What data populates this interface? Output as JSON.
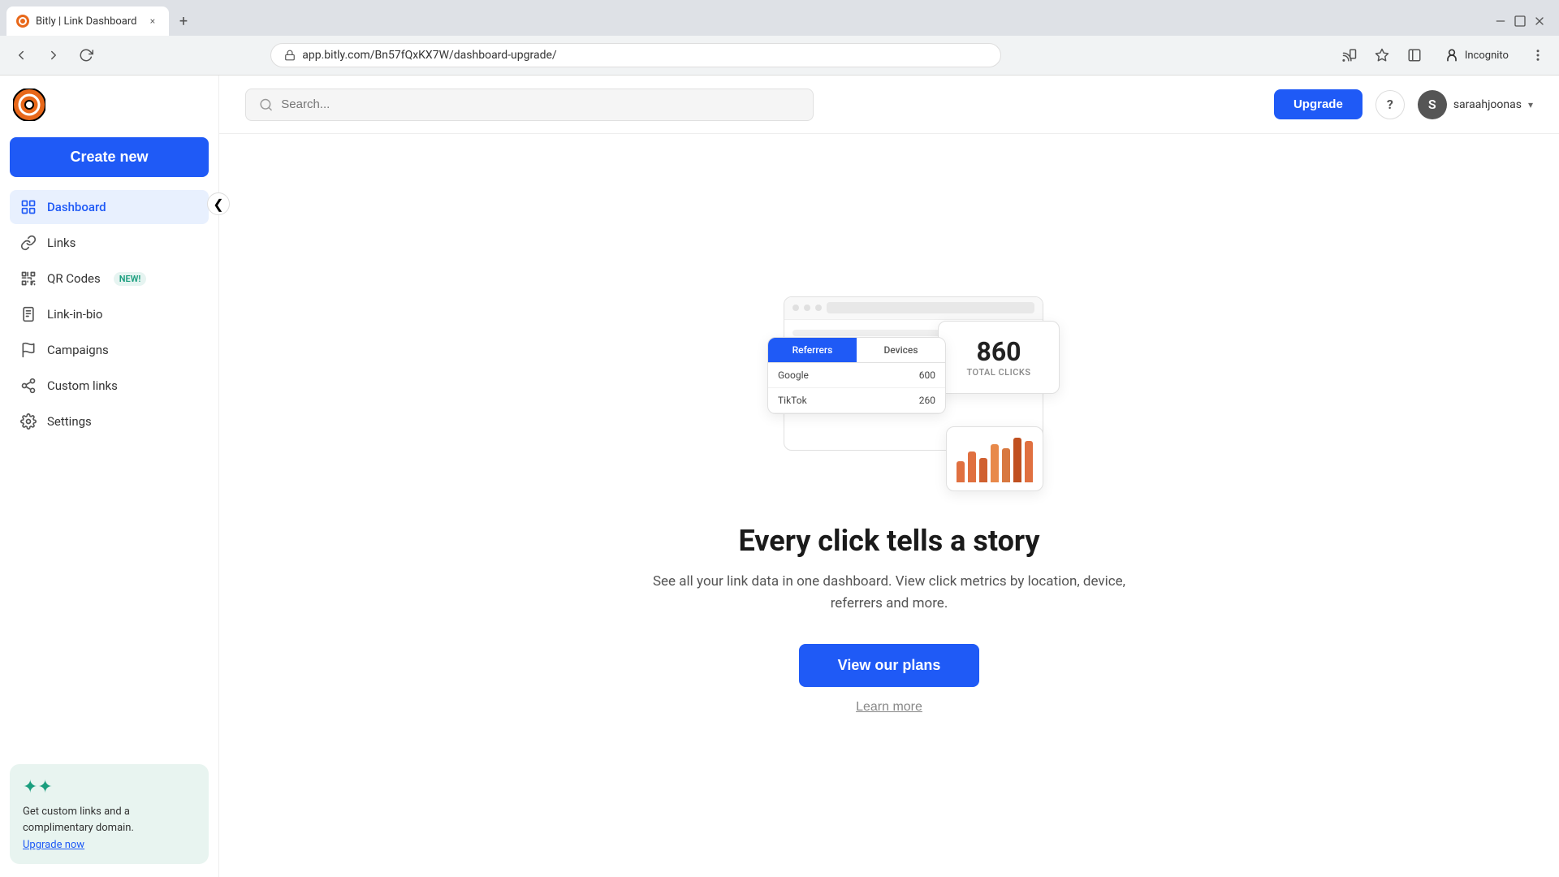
{
  "browser": {
    "tab_title": "Bitly | Link Dashboard",
    "tab_close_symbol": "×",
    "new_tab_symbol": "+",
    "url": "app.bitly.com/Bn57fQxKX7W/dashboard-upgrade/",
    "incognito_label": "Incognito"
  },
  "header": {
    "search_placeholder": "Search...",
    "upgrade_label": "Upgrade",
    "help_symbol": "?",
    "user_initial": "S",
    "user_name": "saraahjoonas",
    "chevron": "▾"
  },
  "sidebar": {
    "collapse_symbol": "❮",
    "create_new_label": "Create new",
    "nav_items": [
      {
        "id": "dashboard",
        "label": "Dashboard",
        "active": true
      },
      {
        "id": "links",
        "label": "Links",
        "active": false
      },
      {
        "id": "qr-codes",
        "label": "QR Codes",
        "active": false,
        "badge": "NEW!"
      },
      {
        "id": "link-in-bio",
        "label": "Link-in-bio",
        "active": false
      },
      {
        "id": "campaigns",
        "label": "Campaigns",
        "active": false
      },
      {
        "id": "custom-links",
        "label": "Custom links",
        "active": false
      },
      {
        "id": "settings",
        "label": "Settings",
        "active": false
      }
    ],
    "promo": {
      "stars_symbol": "✦✦",
      "text": "Get custom links and a complimentary domain.",
      "link_label": "Upgrade now"
    }
  },
  "main": {
    "illustration": {
      "stats_number": "860",
      "stats_label": "TOTAL CLICKS",
      "table_tab1": "Referrers",
      "table_tab2": "Devices",
      "row1_label": "Google",
      "row1_value": "600",
      "row2_label": "TikTok",
      "row2_value": "260",
      "chart_bars": [
        30,
        45,
        35,
        55,
        50,
        65,
        60
      ],
      "star_symbol": "✦"
    },
    "title": "Every click tells a story",
    "description": "See all your link data in one dashboard. View click metrics by location, device, referrers and more.",
    "view_plans_label": "View our plans",
    "learn_more_label": "Learn more"
  }
}
